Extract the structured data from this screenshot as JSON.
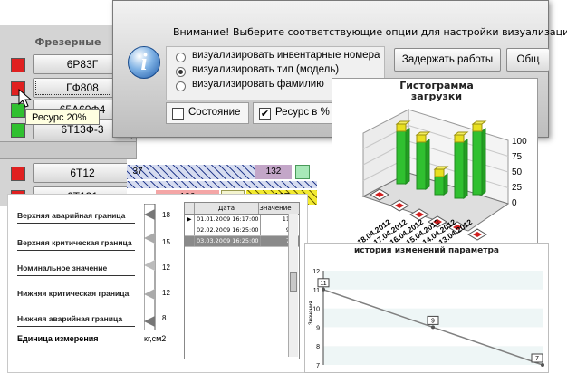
{
  "machines": {
    "group_label": "Фрезерные",
    "items": [
      {
        "name": "6Р83Г",
        "status_color": "#e02020"
      },
      {
        "name": "ГФ808",
        "status_color": "#e02020"
      },
      {
        "name": "65А60Ф4",
        "status_color": "#30c030"
      },
      {
        "name": "6Т13Ф-3",
        "status_color": "#30c030"
      },
      {
        "name": "6Т12",
        "status_color": "#e02020"
      },
      {
        "name": "6Т131",
        "status_color": "#e02020"
      }
    ]
  },
  "tooltip": {
    "text": "Ресурс 20%"
  },
  "gantt": {
    "labels": [
      "37",
      "132",
      "196",
      "30",
      "167"
    ]
  },
  "dialog": {
    "message": "Внимание!  Выберите соответствующие опции для настройки визуализации ди",
    "options": [
      {
        "label": "визуализировать инвентарные номера",
        "selected": false
      },
      {
        "label": "визуализировать тип (модель)",
        "selected": true
      },
      {
        "label": "визуализировать  фамилию",
        "selected": false
      }
    ],
    "delay_button": "Задержать  работы",
    "general_button": "Общ",
    "state_checkbox": {
      "label": "Состояние",
      "checked": false
    },
    "resource_checkbox": {
      "label": "Ресурс в %",
      "checked": true
    }
  },
  "histogram": {
    "title": "Гистограмма загрузки",
    "title_line1": "Гистограмма",
    "title_line2": "загрузки",
    "axis_ticks": [
      "100",
      "75",
      "50",
      "25",
      "0"
    ],
    "dates": [
      "18.04.2012",
      "17.04.2012",
      "16.04.2012",
      "15.04.2012",
      "14.04.2012",
      "13.04.2012"
    ],
    "bar_colors": {
      "top": "#e8e020",
      "body": "#30c030",
      "base": "#d02020"
    }
  },
  "thresholds": {
    "rows": [
      {
        "label": "Верхняя аварийная граница",
        "value": "18"
      },
      {
        "label": "Верхняя критическая граница",
        "value": "15"
      },
      {
        "label": "Номинальное значение",
        "value": "12"
      },
      {
        "label": "Нижняя критическая граница",
        "value": "12"
      },
      {
        "label": "Нижняя аварийная граница",
        "value": "8"
      }
    ],
    "unit_label": "Единица измерения",
    "unit_value": "кг,см2",
    "table": {
      "headers": [
        "",
        "Дата",
        "Значение"
      ],
      "rows": [
        {
          "marker": "▶",
          "date": "01.01.2009 16:17:00",
          "value": "11"
        },
        {
          "marker": "",
          "date": "02.02.2009 16:25:00",
          "value": "9"
        },
        {
          "marker": "",
          "date": "03.03.2009 16:25:00",
          "value": "7"
        }
      ]
    }
  },
  "history_chart": {
    "title": "история изменений параметра",
    "chart_data": {
      "type": "line",
      "ylabel": "Значения",
      "y_ticks": [
        "12",
        "11",
        "10",
        "9",
        "8",
        "7"
      ],
      "ylim": [
        7,
        12
      ],
      "points": [
        {
          "x": 0,
          "y": 11,
          "label": "11"
        },
        {
          "x": 1,
          "y": 9,
          "label": "9"
        },
        {
          "x": 2,
          "y": 7,
          "label": "7"
        }
      ],
      "line_color": "#808080"
    }
  }
}
